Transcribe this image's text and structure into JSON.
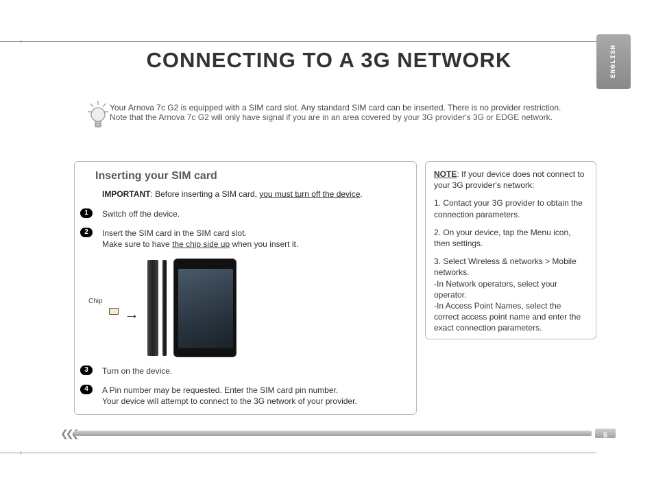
{
  "lang_tab": "ENGLISH",
  "title": "CONNECTING TO A 3G NETWORK",
  "intro": {
    "line1": "Your  Arnova 7c G2 is equipped with a SIM card slot. Any standard SIM card can be inserted. There is no provider restriction.",
    "line2": "Note that the Arnova 7c G2 will only have signal if you are in an area covered by your 3G provider's 3G or EDGE network."
  },
  "main": {
    "heading": "Inserting your SIM card",
    "important_label": "IMPORTANT",
    "important_text_a": ": Before inserting a SIM card, ",
    "important_text_u": "you must turn off the device",
    "important_text_b": ".",
    "steps": {
      "s1": {
        "num": "1",
        "text": "Switch off the device."
      },
      "s2": {
        "num": "2",
        "text_a": "Insert the SIM card in the SIM card slot.",
        "text_b1": "Make sure to have ",
        "text_b_u": "the chip side up",
        "text_b2": " when you insert it."
      },
      "s3": {
        "num": "3",
        "text": "Turn on the device."
      },
      "s4": {
        "num": "4",
        "text_a": "A Pin number may be requested. Enter the SIM card pin number.",
        "text_b": "Your device will attempt to connect to the 3G network of your provider."
      }
    },
    "chip_label": "Chip"
  },
  "note": {
    "heading_label": "NOTE",
    "heading_text": ": If your device does not connect to your 3G provider's network:",
    "p1": "1. Contact your 3G provider to obtain the connection parameters.",
    "p2": "2. On your device, tap the Menu icon, then settings.",
    "p3": "3. Select Wireless & networks > Mobile networks.",
    "p4": "-In Network operators, select your operator.",
    "p5": "-In Access Point Names, select the correct access point name and enter the exact connection parameters."
  },
  "page_number": "5"
}
